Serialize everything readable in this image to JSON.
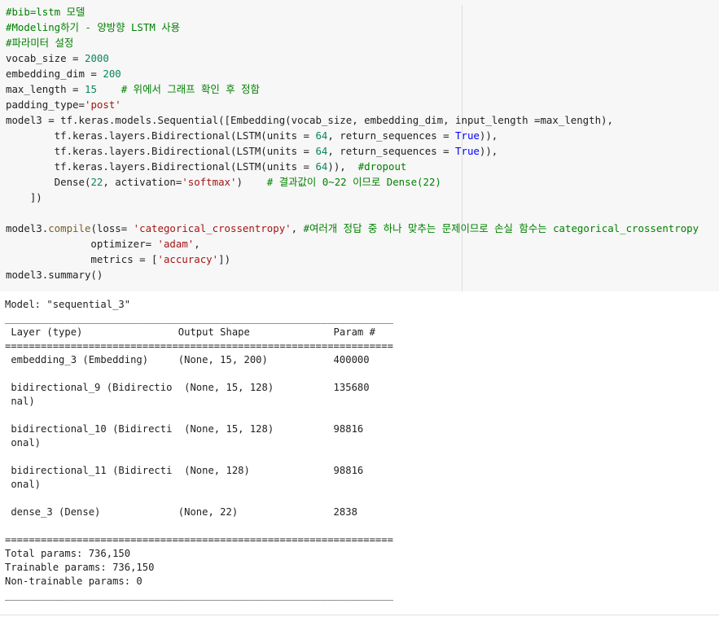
{
  "code_cell": {
    "lines": [
      [
        {
          "t": "#bib=lstm 모델",
          "c": "cm"
        }
      ],
      [
        {
          "t": "#Modeling하기 - 양방향 LSTM 사용",
          "c": "cm"
        }
      ],
      [
        {
          "t": "#파라미터 설정",
          "c": "cm"
        }
      ],
      [
        {
          "t": "vocab_size = ",
          "c": ""
        },
        {
          "t": "2000",
          "c": "num"
        }
      ],
      [
        {
          "t": "embedding_dim = ",
          "c": ""
        },
        {
          "t": "200",
          "c": "num"
        }
      ],
      [
        {
          "t": "max_length = ",
          "c": ""
        },
        {
          "t": "15",
          "c": "num"
        },
        {
          "t": "    ",
          "c": ""
        },
        {
          "t": "# 위에서 그래프 확인 후 정함",
          "c": "cm"
        }
      ],
      [
        {
          "t": "padding_type=",
          "c": ""
        },
        {
          "t": "'post'",
          "c": "str"
        }
      ],
      [
        {
          "t": "model3 = tf.keras.models.Sequential([Embedding(vocab_size, embedding_dim, input_length =max_length),",
          "c": ""
        }
      ],
      [
        {
          "t": "        tf.keras.layers.Bidirectional(LSTM(units = ",
          "c": ""
        },
        {
          "t": "64",
          "c": "num"
        },
        {
          "t": ", return_sequences = ",
          "c": ""
        },
        {
          "t": "True",
          "c": "kw"
        },
        {
          "t": ")),",
          "c": ""
        }
      ],
      [
        {
          "t": "        tf.keras.layers.Bidirectional(LSTM(units = ",
          "c": ""
        },
        {
          "t": "64",
          "c": "num"
        },
        {
          "t": ", return_sequences = ",
          "c": ""
        },
        {
          "t": "True",
          "c": "kw"
        },
        {
          "t": ")),",
          "c": ""
        }
      ],
      [
        {
          "t": "        tf.keras.layers.Bidirectional(LSTM(units = ",
          "c": ""
        },
        {
          "t": "64",
          "c": "num"
        },
        {
          "t": ")),  ",
          "c": ""
        },
        {
          "t": "#dropout",
          "c": "cm"
        }
      ],
      [
        {
          "t": "        Dense(",
          "c": ""
        },
        {
          "t": "22",
          "c": "num"
        },
        {
          "t": ", activation=",
          "c": ""
        },
        {
          "t": "'softmax'",
          "c": "str"
        },
        {
          "t": ")    ",
          "c": ""
        },
        {
          "t": "# 결과값이 0~22 이므로 Dense(22)",
          "c": "cm"
        }
      ],
      [
        {
          "t": "    ])",
          "c": ""
        }
      ],
      [
        {
          "t": "",
          "c": ""
        }
      ],
      [
        {
          "t": "model3.",
          "c": ""
        },
        {
          "t": "compile",
          "c": "fn"
        },
        {
          "t": "(loss= ",
          "c": ""
        },
        {
          "t": "'categorical_crossentropy'",
          "c": "str"
        },
        {
          "t": ", ",
          "c": ""
        },
        {
          "t": "#여러개 정답 중 하나 맞추는 문제이므로 손실 함수는 categorical_crossentropy",
          "c": "cm"
        }
      ],
      [
        {
          "t": "              optimizer= ",
          "c": ""
        },
        {
          "t": "'adam'",
          "c": "str"
        },
        {
          "t": ",",
          "c": ""
        }
      ],
      [
        {
          "t": "              metrics = [",
          "c": ""
        },
        {
          "t": "'accuracy'",
          "c": "str"
        },
        {
          "t": "])",
          "c": ""
        }
      ],
      [
        {
          "t": "model3.summary()",
          "c": ""
        }
      ]
    ]
  },
  "output": {
    "lines": [
      "Model: \"sequential_3\"",
      "_________________________________________________________________",
      " Layer (type)                Output Shape              Param #   ",
      "=================================================================",
      " embedding_3 (Embedding)     (None, 15, 200)           400000    ",
      "",
      " bidirectional_9 (Bidirectio  (None, 15, 128)          135680    ",
      " nal)                                                            ",
      "",
      " bidirectional_10 (Bidirecti  (None, 15, 128)          98816     ",
      " onal)                                                           ",
      "",
      " bidirectional_11 (Bidirecti  (None, 128)              98816     ",
      " onal)                                                           ",
      "",
      " dense_3 (Dense)             (None, 22)                2838      ",
      "",
      "=================================================================",
      "Total params: 736,150",
      "Trainable params: 736,150",
      "Non-trainable params: 0",
      "_________________________________________________________________"
    ]
  }
}
